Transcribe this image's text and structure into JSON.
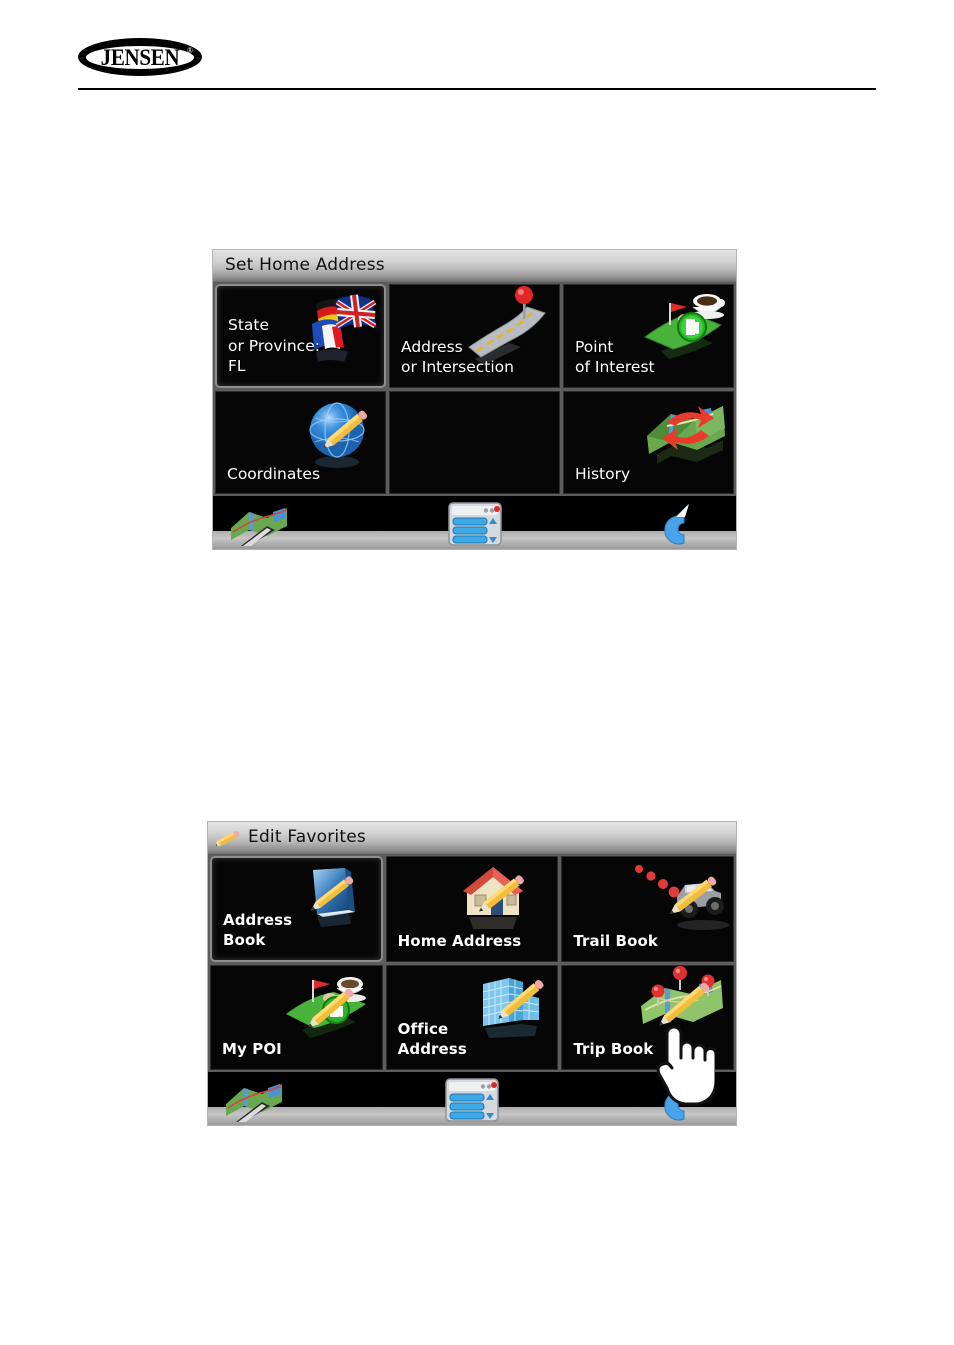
{
  "page": {
    "brand": "JENSEN",
    "brand_mark": "®"
  },
  "screens": [
    {
      "id": "set-home-address",
      "title": "Set Home Address",
      "title_icon": "none",
      "tiles": [
        {
          "label": "State\nor Province:\nFL",
          "icon": "flags-icon",
          "selected": true,
          "empty": false
        },
        {
          "label": "Address\nor Intersection",
          "icon": "road-pin-icon",
          "selected": false,
          "empty": false
        },
        {
          "label": "Point\nof Interest",
          "icon": "poi-icon",
          "selected": false,
          "empty": false
        },
        {
          "label": "Coordinates",
          "icon": "globe-pencil-icon",
          "selected": false,
          "empty": false
        },
        {
          "label": "",
          "icon": "none",
          "selected": false,
          "empty": true
        },
        {
          "label": "History",
          "icon": "map-arrows-icon",
          "selected": false,
          "empty": false
        }
      ],
      "toolbar": {
        "map_label": "map-icon",
        "list_label": "list-menu-icon",
        "back_label": "return-arrow-icon"
      },
      "cursor": null
    },
    {
      "id": "edit-favorites",
      "title": "Edit Favorites",
      "title_icon": "pencil-icon",
      "tiles": [
        {
          "label": "Address\nBook",
          "icon": "book-pencil-icon",
          "selected": true,
          "empty": false
        },
        {
          "label": "Home Address",
          "icon": "house-pencil-icon",
          "selected": false,
          "empty": false
        },
        {
          "label": "Trail Book",
          "icon": "jeep-pencil-icon",
          "selected": false,
          "empty": false
        },
        {
          "label": "My POI",
          "icon": "poi-pencil-icon",
          "selected": false,
          "empty": false
        },
        {
          "label": "Office\nAddress",
          "icon": "office-pencil-icon",
          "selected": false,
          "empty": false
        },
        {
          "label": "Trip Book",
          "icon": "map-pins-pencil-icon",
          "selected": false,
          "empty": false
        }
      ],
      "toolbar": {
        "map_label": "map-icon",
        "list_label": "list-menu-icon",
        "back_label": "return-arrow-icon"
      },
      "cursor": "hand-pointer"
    }
  ],
  "colors": {
    "screen_bg": "#000000",
    "titlebar_light": "#e4e4e4",
    "titlebar_dark": "#6d6d6d",
    "tile_border": "#5c5c5c",
    "label_text": "#ffffff",
    "toolbar_strip": "#b4b4b4",
    "accent_blue": "#4aa3e8",
    "accent_green": "#3fbd3f",
    "accent_red": "#e02020"
  }
}
